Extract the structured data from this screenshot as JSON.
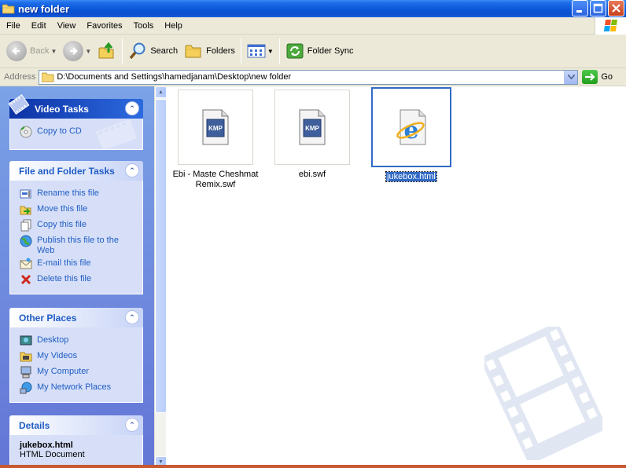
{
  "window": {
    "title": "new folder"
  },
  "menu": [
    "File",
    "Edit",
    "View",
    "Favorites",
    "Tools",
    "Help"
  ],
  "toolbar": {
    "back": "Back",
    "search": "Search",
    "folders": "Folders",
    "folder_sync": "Folder Sync"
  },
  "address": {
    "label": "Address",
    "value": "D:\\Documents and Settings\\hamedjanam\\Desktop\\new folder",
    "go": "Go"
  },
  "panels": {
    "video_tasks": {
      "title": "Video Tasks",
      "items": [
        "Copy to CD"
      ]
    },
    "file_tasks": {
      "title": "File and Folder Tasks",
      "items": [
        "Rename this file",
        "Move this file",
        "Copy this file",
        "Publish this file to the Web",
        "E-mail this file",
        "Delete this file"
      ]
    },
    "other_places": {
      "title": "Other Places",
      "items": [
        "Desktop",
        "My Videos",
        "My Computer",
        "My Network Places"
      ]
    },
    "details": {
      "title": "Details",
      "name": "jukebox.html",
      "type": "HTML Document"
    }
  },
  "files": [
    {
      "name": "Ebi - Maste Cheshmat Remix.swf",
      "icon": "kmp-file-icon",
      "selected": false
    },
    {
      "name": "ebi.swf",
      "icon": "kmp-file-icon",
      "selected": false
    },
    {
      "name": "jukebox.html",
      "icon": "internet-explorer-icon",
      "selected": true
    }
  ],
  "colors": {
    "selection": "#316ac5",
    "title_bar": "#0a56d8",
    "task_link": "#215dc6"
  }
}
